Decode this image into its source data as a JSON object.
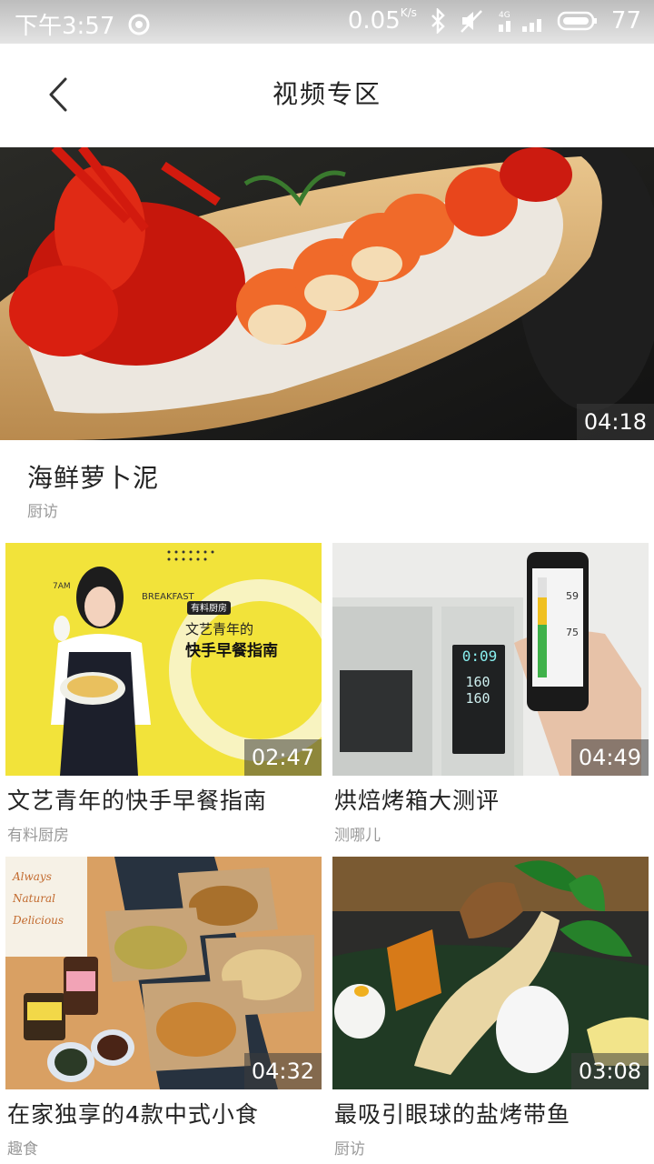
{
  "status_bar": {
    "time": "下午3:57",
    "net_speed": "0.05",
    "net_unit": "K/s",
    "network_type": "4G",
    "battery": "77"
  },
  "header": {
    "title": "视频专区"
  },
  "featured": {
    "title": "海鲜萝卜泥",
    "source": "厨访",
    "duration": "04:18"
  },
  "videos": [
    {
      "title": "文艺青年的快手早餐指南",
      "source": "有料厨房",
      "duration": "02:47",
      "thumb_text": {
        "brand": "有料厨房",
        "headline_1": "文艺青年的",
        "headline_2": "快手早餐指南",
        "corner_left": "7AM",
        "corner_right": "BREAKFAST"
      }
    },
    {
      "title": "烘焙烤箱大测评",
      "source": "测哪儿",
      "duration": "04:49",
      "thumb_text": {
        "panel_1": "0:09",
        "panel_2": "160",
        "panel_3": "160",
        "phone_1": "59",
        "phone_2": "75"
      }
    },
    {
      "title": "在家独享的4款中式小食",
      "source": "趣食",
      "duration": "04:32",
      "thumb_text": {
        "box_1": "Always",
        "box_2": "Natural",
        "box_3": "Delicious"
      }
    },
    {
      "title": "最吸引眼球的盐烤带鱼",
      "source": "厨访",
      "duration": "03:08"
    }
  ]
}
